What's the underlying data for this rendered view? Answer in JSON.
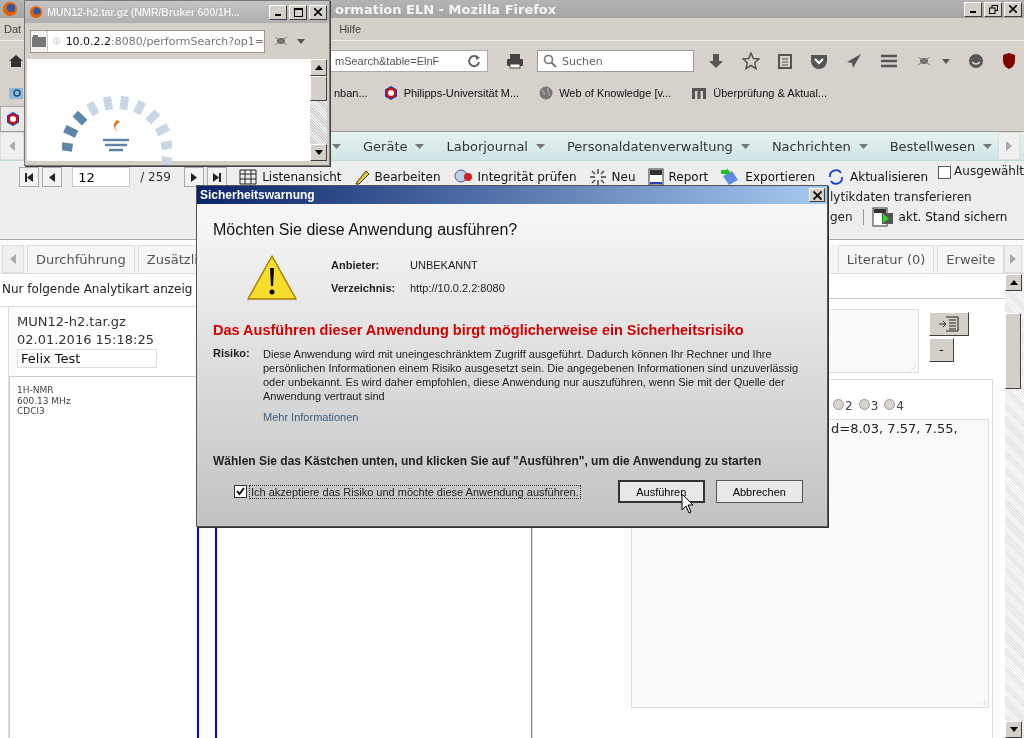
{
  "browser": {
    "title": "ormation ELN - Mozilla Firefox",
    "menu": [
      "Dat",
      "Hilfe"
    ],
    "url": "mSearch&table=ElnF",
    "search": {
      "placeholder": "Suchen"
    },
    "bookmarks": [
      "nban...",
      "Philipps-Universität M...",
      "Web of Knowledge [v...",
      "Überprüfung & Aktual..."
    ]
  },
  "app_menu": [
    "Geräte",
    "Laborjournal",
    "Personaldatenverwaltung",
    "Nachrichten",
    "Bestellwesen"
  ],
  "toolbar": {
    "record": "12",
    "total": "/ 259",
    "actions": [
      "Listenansicht",
      "Bearbeiten",
      "Integrität prüfen",
      "Neu",
      "Report",
      "Exportieren",
      "Aktualisieren"
    ],
    "filter": {
      "label": "Ausgewählt",
      "checked": false
    },
    "transfer": "lytikdaten transferieren",
    "partial": "gen",
    "save": "akt. Stand sichern"
  },
  "tabs_left": [
    {
      "label": "Durchführung",
      "selected": false
    },
    {
      "label": "Zusätzli",
      "selected": false
    }
  ],
  "tabs_right": [
    {
      "label": "Literatur (0)",
      "selected": false
    },
    {
      "label": "Erweite",
      "selected": false
    }
  ],
  "analysis": {
    "filter_label": "Nur folgende Analytikart anzeig",
    "file": "MUN12-h2.tar.gz",
    "date": "02.01.2016 15:18:25",
    "user": "Felix Test",
    "spectrum_info": [
      "1H-NMR",
      "600.13 MHz",
      "CDCl3"
    ]
  },
  "details": {
    "minus": "-",
    "radios": [
      {
        "label": "2",
        "selected": false
      },
      {
        "label": "3",
        "selected": false
      },
      {
        "label": "4",
        "selected": false
      }
    ],
    "peaks": "d=8.03, 7.57, 7.55,"
  },
  "popup": {
    "title": "MUN12-h2.tar.gz (NMR/Bruker 600/1H...",
    "url_host": "10.0.2.2",
    "url_rest": ":8080/performSearch?op1="
  },
  "dialog": {
    "title": "Sicherheitswarnung",
    "question": "Möchten Sie diese Anwendung ausführen?",
    "publisher_label": "Anbieter:",
    "publisher": "UNBEKANNT",
    "location_label": "Verzeichnis:",
    "location": "http://10.0.2.2:8080",
    "warning": "Das Ausführen dieser Anwendung birgt möglicherweise ein Sicherheitsrisiko",
    "risk_label": "Risiko:",
    "risk_text": "Diese Anwendung wird mit uneingeschränktem Zugriff ausgeführt. Dadurch können Ihr Rechner und Ihre persönlichen Informationen einem Risiko ausgesetzt sein. Die angegebenen Informationen sind unzuverlässig oder unbekannt. Es wird daher empfohlen, diese Anwendung nur auszuführen, wenn Sie mit der Quelle der Anwendung vertraut sind",
    "more": "Mehr Informationen",
    "instruction": "Wählen Sie das Kästchen unten, und klicken Sie auf \"Ausführen\", um die Anwendung zu starten",
    "accept": {
      "label": "Ich akzeptiere das Risiko und möchte diese Anwendung ausführen.",
      "checked": true
    },
    "buttons": [
      "Ausführen",
      "Abbrechen"
    ]
  }
}
